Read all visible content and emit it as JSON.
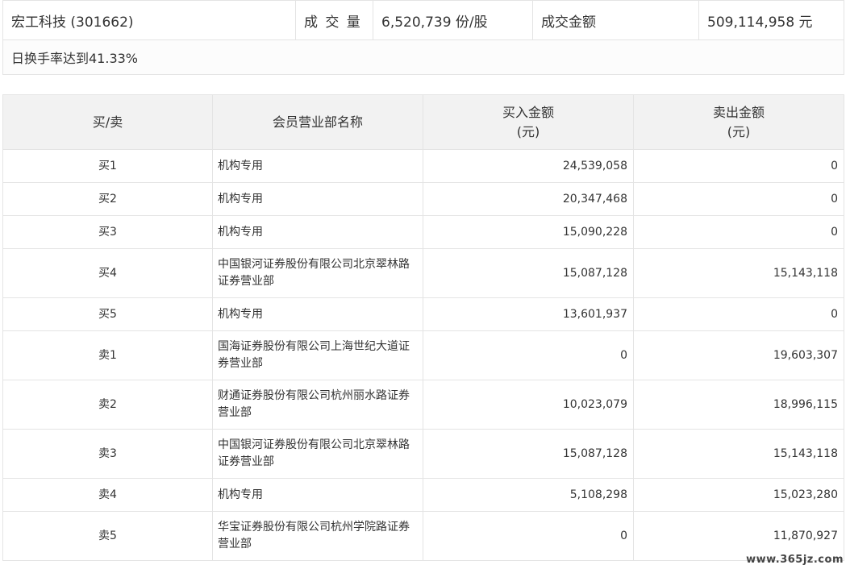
{
  "summary": {
    "stock": "宏工科技 (301662)",
    "volume_label": "成 交 量",
    "volume_value": "6,520,739 份/股",
    "amount_label": "成交金额",
    "amount_value": "509,114,958 元",
    "note": "日换手率达到41.33%"
  },
  "table": {
    "headers": {
      "side": "买/卖",
      "member": "会员营业部名称",
      "buy_line1": "买入金额",
      "buy_line2": "(元)",
      "sell_line1": "卖出金额",
      "sell_line2": "(元)"
    },
    "rows": [
      {
        "side": "买1",
        "name": "机构专用",
        "buy": "24,539,058",
        "sell": "0"
      },
      {
        "side": "买2",
        "name": "机构专用",
        "buy": "20,347,468",
        "sell": "0"
      },
      {
        "side": "买3",
        "name": "机构专用",
        "buy": "15,090,228",
        "sell": "0"
      },
      {
        "side": "买4",
        "name": "中国银河证券股份有限公司北京翠林路证券营业部",
        "buy": "15,087,128",
        "sell": "15,143,118"
      },
      {
        "side": "买5",
        "name": "机构专用",
        "buy": "13,601,937",
        "sell": "0"
      },
      {
        "side": "卖1",
        "name": "国海证券股份有限公司上海世纪大道证券营业部",
        "buy": "0",
        "sell": "19,603,307"
      },
      {
        "side": "卖2",
        "name": "财通证券股份有限公司杭州丽水路证券营业部",
        "buy": "10,023,079",
        "sell": "18,996,115"
      },
      {
        "side": "卖3",
        "name": "中国银河证券股份有限公司北京翠林路证券营业部",
        "buy": "15,087,128",
        "sell": "15,143,118"
      },
      {
        "side": "卖4",
        "name": "机构专用",
        "buy": "5,108,298",
        "sell": "15,023,280"
      },
      {
        "side": "卖5",
        "name": "华宝证券股份有限公司杭州学院路证券营业部",
        "buy": "0",
        "sell": "11,870,927"
      }
    ]
  },
  "watermark": "www.365jz.com"
}
